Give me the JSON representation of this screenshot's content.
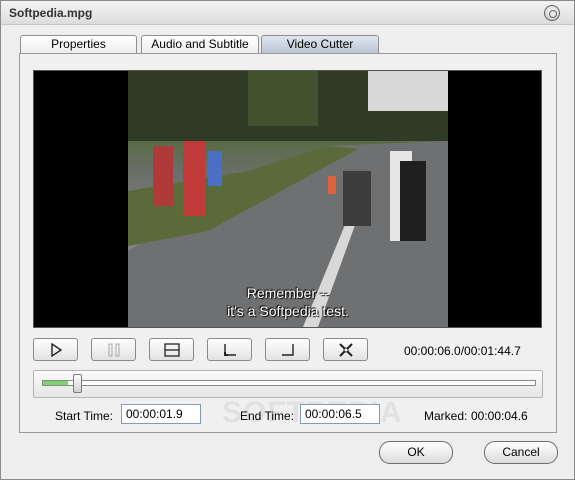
{
  "window": {
    "title": "Softpedia.mpg"
  },
  "tabs": [
    {
      "label": "Properties",
      "active": false
    },
    {
      "label": "Audio and Subtitle",
      "active": false
    },
    {
      "label": "Video Cutter",
      "active": true
    }
  ],
  "video": {
    "subtitle_line1": "Remember --",
    "subtitle_line2": "it's a Softpedia test."
  },
  "controls": {
    "play_icon": "play-icon",
    "pause_icon": "pause-icon",
    "stop_icon": "stop-icon",
    "mark_start_icon": "mark-start-icon",
    "mark_end_icon": "mark-end-icon",
    "cut_icon": "scissors-icon",
    "time_readout": "00:00:06.0/00:01:44.7"
  },
  "slider": {
    "position_fraction": 0.07,
    "selected_fraction": 0.05
  },
  "fields": {
    "start_label": "Start Time:",
    "start_value": "00:00:01.9",
    "end_label": "End Time:",
    "end_value": "00:00:06.5",
    "marked_label": "Marked:",
    "marked_value": "00:00:04.6"
  },
  "buttons": {
    "ok": "OK",
    "cancel": "Cancel"
  },
  "watermark": "SOFTPEDIA"
}
